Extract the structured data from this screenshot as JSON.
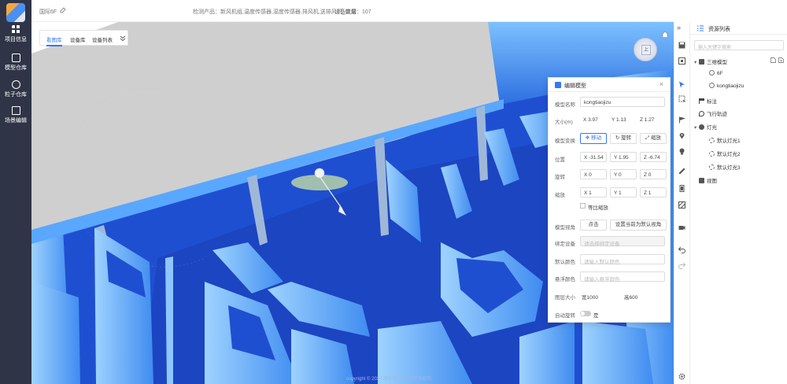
{
  "rail": {
    "items": [
      {
        "label": "项目信息"
      },
      {
        "label": "模型仓库"
      },
      {
        "label": "粒子仓库"
      },
      {
        "label": "场景编辑"
      }
    ]
  },
  "topbar": {
    "scene_name": "国际6F",
    "product_label": "检测产品：新风机组,温度传感器,湿度传感器,排风机,送排风机_废烟",
    "device_count": "设备数量：107"
  },
  "tabs": [
    {
      "label": "看图库",
      "active": true
    },
    {
      "label": "设备库",
      "active": false
    },
    {
      "label": "设备列表",
      "active": false
    }
  ],
  "compass": {
    "face": "上"
  },
  "dialog": {
    "title": "编辑模型",
    "name_label": "模型名称",
    "name_value": "kongtiaojizu",
    "size_label": "大小(m)",
    "size_x": "X 3.97",
    "size_y": "Y 1.13",
    "size_z": "Z 1.27",
    "transform_label": "模型变换",
    "move_btn": "移动",
    "rotate_btn": "旋转",
    "scale_btn": "缩放",
    "position_label": "位置",
    "pos_x": "X -31.54",
    "pos_y": "Y 1.95",
    "pos_z": "Z -6.74",
    "rotation_label": "旋转",
    "rot_x": "X 0",
    "rot_y": "Y 0",
    "rot_z": "Z 0",
    "scale_label": "缩放",
    "scl_x": "X 1",
    "scl_y": "Y 1",
    "scl_z": "Z 1",
    "uniform_scale_label": "等比缩放",
    "view_label": "模型视角",
    "view_btn": "点击",
    "default_view_btn": "设置当前为默认视角",
    "device_label": "绑定设备",
    "device_placeholder": "请选择绑定设备",
    "default_color_label": "默认颜色",
    "default_color_placeholder": "请输入默认颜色",
    "selected_color_label": "悬浮颜色",
    "selected_color_placeholder": "请输入悬浮颜色",
    "image_size_label": "图层大小",
    "image_width": "宽1000",
    "image_height": "高600",
    "auto_rotate_label": "自动旋转",
    "auto_rotate_value": "是"
  },
  "panel": {
    "title": "资源列表",
    "search_placeholder": "输入关键字搜索",
    "tree": [
      {
        "label": "三维模型",
        "level": 0,
        "expanded": true
      },
      {
        "label": "6F",
        "level": 1
      },
      {
        "label": "kongtiaojizu",
        "level": 1
      },
      {
        "label": "标注",
        "level": 0
      },
      {
        "label": "飞行轨迹",
        "level": 0
      },
      {
        "label": "灯光",
        "level": 0,
        "expanded": true
      },
      {
        "label": "默认灯光1",
        "level": 1
      },
      {
        "label": "默认灯光2",
        "level": 1
      },
      {
        "label": "默认灯光3",
        "level": 1
      },
      {
        "label": "视图",
        "level": 0
      }
    ]
  },
  "footer": {
    "copyright": "copyright © 2024 版权所有 保留所有权利"
  },
  "colors": {
    "rail_bg": "#2f3547",
    "accent": "#3478f6",
    "floor": "#1f4fd1",
    "wall_light": "#6fb7ff",
    "wall_dark": "#2f74e8",
    "roof": "#cfcfcf"
  }
}
